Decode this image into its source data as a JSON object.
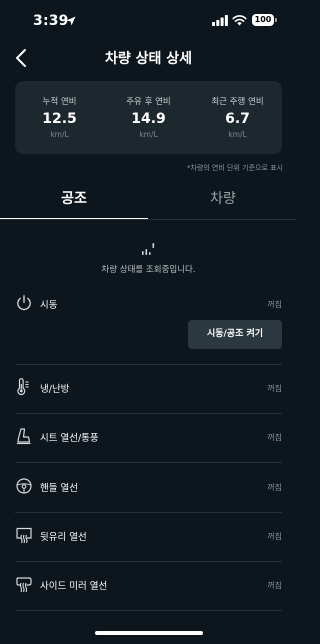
{
  "status_bar": {
    "time": "3:39",
    "battery": "100"
  },
  "header": {
    "title": "차량 상태 상세"
  },
  "fuel_card": {
    "items": [
      {
        "label": "누적 연비",
        "value": "12.5",
        "unit": "km/L"
      },
      {
        "label": "주유 후 연비",
        "value": "14.9",
        "unit": "km/L"
      },
      {
        "label": "최근 주행 연비",
        "value": "6.7",
        "unit": "km/L"
      }
    ],
    "note": "*차량의 연비 단위 기준으로 표시"
  },
  "tabs": [
    {
      "label": "공조",
      "active": true
    },
    {
      "label": "차량",
      "active": false
    }
  ],
  "loading": {
    "text": "차량 상태를 조회중입니다."
  },
  "rows": [
    {
      "label": "시동",
      "state": "꺼짐",
      "icon": "power-icon"
    },
    {
      "label": "냉/난방",
      "state": "꺼짐",
      "icon": "thermometer-icon"
    },
    {
      "label": "시트 열선/통풍",
      "state": "꺼짐",
      "icon": "seat-icon"
    },
    {
      "label": "핸들 열선",
      "state": "꺼짐",
      "icon": "steering-wheel-icon"
    },
    {
      "label": "뒷유리 열선",
      "state": "꺼짐",
      "icon": "rear-defrost-icon"
    },
    {
      "label": "사이드 미러 열선",
      "state": "꺼짐",
      "icon": "mirror-heat-icon"
    }
  ],
  "start_button": {
    "label": "시동/공조 켜기"
  },
  "colors": {
    "background": "#0d161c",
    "card": "#1c272e",
    "button": "#2c383f"
  }
}
